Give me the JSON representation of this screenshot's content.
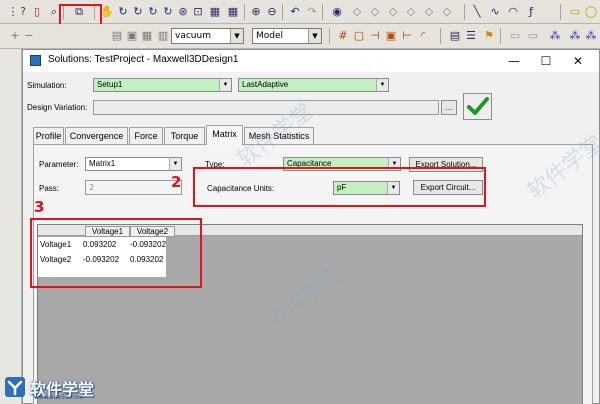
{
  "toolbar": {
    "material_combo": "vacuum",
    "view_combo": "Model"
  },
  "dialog": {
    "title": "Solutions: TestProject - Maxwell3DDesign1",
    "minimize": "—",
    "maximize": "☐",
    "close": "✕",
    "simulation_label": "Simulation:",
    "simulation_setup": "Setup1",
    "simulation_pass": "LastAdaptive",
    "design_variation_label": "Design Variation:",
    "design_variation_btn": "...",
    "tabs": [
      {
        "label": "Profile"
      },
      {
        "label": "Convergence"
      },
      {
        "label": "Force"
      },
      {
        "label": "Torque"
      },
      {
        "label": "Matrix"
      },
      {
        "label": "Mesh Statistics"
      }
    ],
    "parameter_label": "Parameter:",
    "parameter_value": "Matrix1",
    "type_label": "Type:",
    "type_value": "Capacitance",
    "export_solution": "Export Solution...",
    "pass_label": "Pass:",
    "pass_value": "2",
    "cap_units_label": "Capacitance Units:",
    "cap_units_value": "pF",
    "export_circuit": "Export Circuit...",
    "matrix": {
      "columns": [
        "Voltage1",
        "Voltage2"
      ],
      "rows": [
        {
          "name": "Voltage1",
          "values": [
            "0.093202",
            "-0.093202"
          ]
        },
        {
          "name": "Voltage2",
          "values": [
            "-0.093202",
            "0.093202"
          ]
        }
      ]
    }
  },
  "annotations": {
    "a2": "2",
    "a3": "3"
  },
  "brand": {
    "name": "软件学堂",
    "url": "www.xue51.com"
  },
  "watermark": "软件学堂"
}
